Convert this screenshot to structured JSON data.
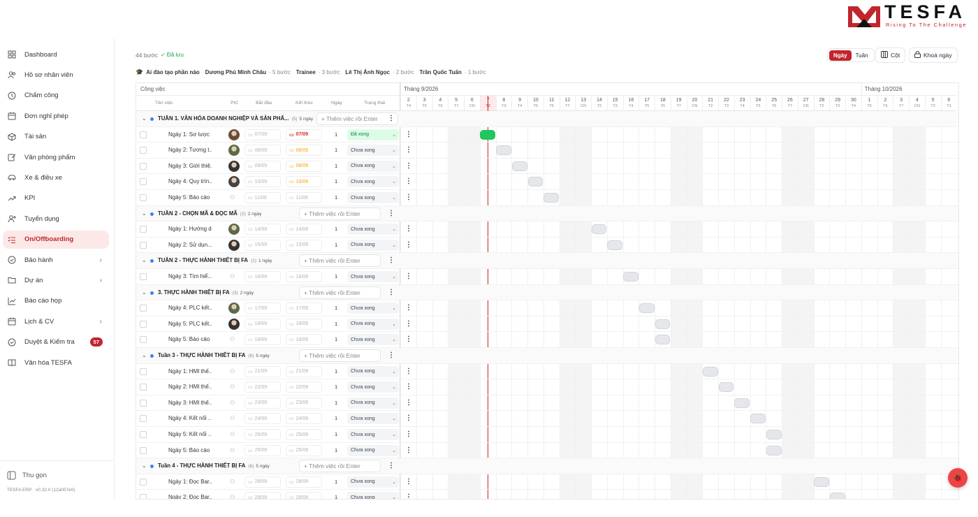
{
  "brand": {
    "name": "TESFA",
    "tagline": "Rising To The Challenge"
  },
  "sidebar": {
    "items": [
      {
        "label": "Dashboard",
        "icon": "grid-icon"
      },
      {
        "label": "Hồ sơ nhân viên",
        "icon": "users-icon"
      },
      {
        "label": "Chấm công",
        "icon": "clock-icon"
      },
      {
        "label": "Đơn nghỉ phép",
        "icon": "calendar-icon"
      },
      {
        "label": "Tài sản",
        "icon": "box-icon"
      },
      {
        "label": "Văn phòng phẩm",
        "icon": "edit-icon"
      },
      {
        "label": "Xe & điều xe",
        "icon": "car-icon"
      },
      {
        "label": "KPI",
        "icon": "trend-icon"
      },
      {
        "label": "Tuyển dụng",
        "icon": "user-plus-icon"
      },
      {
        "label": "On/Offboarding",
        "icon": "list-check-icon",
        "active": true
      },
      {
        "label": "Bảo hành",
        "icon": "check-circle-icon",
        "chevron": true
      },
      {
        "label": "Dự án",
        "icon": "folder-icon",
        "chevron": true
      },
      {
        "label": "Báo cáo họp",
        "icon": "chart-icon"
      },
      {
        "label": "Lịch & CV",
        "icon": "calendar-icon",
        "chevron": true
      },
      {
        "label": "Duyệt & Kiểm tra",
        "icon": "check-circle-icon",
        "badge": "57"
      },
      {
        "label": "Văn hóa TESFA",
        "icon": "book-icon"
      }
    ],
    "collapse_label": "Thu gọn",
    "version": "TESFA ERP · v0.32.0 (12a007e0)"
  },
  "toolbar": {
    "step_count": "44 bước",
    "saved": "✓ Đã lưu",
    "view_day": "Ngày",
    "view_week": "Tuần",
    "columns_label": "Cột",
    "lock_label": "Khoá ngày"
  },
  "summary": {
    "prefix": "Ai đào tạo phần nào",
    "people": [
      {
        "name": "Dương Phú Minh Châu",
        "steps": "· 5 bước"
      },
      {
        "name": "Trainee",
        "steps": "· 3 bước"
      },
      {
        "name": "Lê Thị Ánh Ngọc",
        "steps": "· 2 bước"
      },
      {
        "name": "Trần Quốc Tuấn",
        "steps": "· 1 bước"
      }
    ]
  },
  "table": {
    "section_label": "Công việc",
    "columns": {
      "name": "Tên việc",
      "pic": "PIC",
      "start": "Bắt đầu",
      "end": "Kết thúc",
      "days": "Ngày",
      "status": "Trạng thái"
    },
    "add_placeholder": "+ Thêm việc rồi Enter",
    "rows": [
      {
        "type": "group",
        "title": "TUẦN 1. VĂN HÓA DOANH NGHIỆP VÀ SẢN PHẨ...",
        "count": "(5)",
        "days": "5 ngày"
      },
      {
        "type": "task",
        "name": "Ngày 1: Sơ lược ...",
        "pic": "avatar",
        "start": "07/09",
        "end": "07/09",
        "days": "1",
        "status": "Đã xong",
        "end_style": "red",
        "done": true,
        "bar": [
          5,
          1
        ],
        "bar_color": "green"
      },
      {
        "type": "task",
        "name": "Ngày 2: Tương t...",
        "pic": "avatar",
        "start": "08/09",
        "end": "08/09",
        "days": "1",
        "status": "Chưa xong",
        "end_style": "orange",
        "bar": [
          6,
          1
        ]
      },
      {
        "type": "task",
        "name": "Ngày 3: Giới thiệ...",
        "pic": "avatar",
        "start": "09/09",
        "end": "09/09",
        "days": "1",
        "status": "Chưa xong",
        "end_style": "orange",
        "bar": [
          7,
          1
        ]
      },
      {
        "type": "task",
        "name": "Ngày 4: Quy trìn...",
        "pic": "avatar",
        "start": "10/09",
        "end": "10/09",
        "days": "1",
        "status": "Chưa xong",
        "end_style": "orange",
        "bar": [
          8,
          1
        ]
      },
      {
        "type": "task",
        "name": "Ngày 5: Báo cáo",
        "pic": "none",
        "start": "11/09",
        "end": "11/09",
        "days": "1",
        "status": "Chưa xong",
        "bar": [
          9,
          1
        ]
      },
      {
        "type": "group",
        "title": "TUẦN 2 - CHỌN MÃ & ĐỌC MÃ",
        "count": "(2)",
        "days": "2 ngày"
      },
      {
        "type": "task",
        "name": "Ngày 1: Hướng d...",
        "pic": "avatar",
        "start": "14/09",
        "end": "14/09",
        "days": "1",
        "status": "Chưa xong",
        "bar": [
          12,
          1
        ]
      },
      {
        "type": "task",
        "name": "Ngày 2: Sử dụn...",
        "pic": "avatar",
        "start": "15/09",
        "end": "15/09",
        "days": "1",
        "status": "Chưa xong",
        "bar": [
          13,
          1
        ]
      },
      {
        "type": "group",
        "title": "TUẦN 2 - THỰC HÀNH THIẾT BỊ FA",
        "count": "(1)",
        "days": "1 ngày"
      },
      {
        "type": "task",
        "name": "Ngày 3: Tìm hiể...",
        "pic": "none",
        "start": "16/09",
        "end": "16/09",
        "days": "1",
        "status": "Chưa xong",
        "bar": [
          14,
          1
        ]
      },
      {
        "type": "group",
        "title": "3. THỰC HÀNH THIẾT BỊ FA",
        "count": "(3)",
        "days": "2 ngày"
      },
      {
        "type": "task",
        "name": "Ngày 4: PLC kết...",
        "pic": "avatar",
        "start": "17/09",
        "end": "17/09",
        "days": "1",
        "status": "Chưa xong",
        "bar": [
          15,
          1
        ]
      },
      {
        "type": "task",
        "name": "Ngày 5: PLC kết...",
        "pic": "avatar",
        "start": "18/09",
        "end": "18/09",
        "days": "1",
        "status": "Chưa xong",
        "bar": [
          16,
          1
        ]
      },
      {
        "type": "task",
        "name": "Ngày 5: Báo cáo",
        "pic": "none",
        "start": "18/09",
        "end": "18/09",
        "days": "1",
        "status": "Chưa xong",
        "bar": [
          16,
          1
        ]
      },
      {
        "type": "group",
        "title": "Tuần 3 - THỰC HÀNH THIẾT BỊ FA",
        "count": "(6)",
        "days": "5 ngày"
      },
      {
        "type": "task",
        "name": "Ngày 1: HMI thế...",
        "pic": "none",
        "start": "21/09",
        "end": "21/09",
        "days": "1",
        "status": "Chưa xong",
        "bar": [
          19,
          1
        ]
      },
      {
        "type": "task",
        "name": "Ngày 2: HMI thế...",
        "pic": "none",
        "start": "22/09",
        "end": "22/09",
        "days": "1",
        "status": "Chưa xong",
        "bar": [
          20,
          1
        ]
      },
      {
        "type": "task",
        "name": "Ngày 3: HMI thế...",
        "pic": "none",
        "start": "23/09",
        "end": "23/09",
        "days": "1",
        "status": "Chưa xong",
        "bar": [
          21,
          1
        ]
      },
      {
        "type": "task",
        "name": "Ngày 4: Kết nối ...",
        "pic": "none",
        "start": "24/09",
        "end": "24/09",
        "days": "1",
        "status": "Chưa xong",
        "bar": [
          22,
          1
        ]
      },
      {
        "type": "task",
        "name": "Ngày 5: Kết nối ...",
        "pic": "none",
        "start": "25/09",
        "end": "25/09",
        "days": "1",
        "status": "Chưa xong",
        "bar": [
          23,
          1
        ]
      },
      {
        "type": "task",
        "name": "Ngày 5: Báo cáo",
        "pic": "none",
        "start": "25/09",
        "end": "25/09",
        "days": "1",
        "status": "Chưa xong",
        "bar": [
          23,
          1
        ]
      },
      {
        "type": "group",
        "title": "Tuần 4 - THỰC HÀNH THIẾT BỊ FA",
        "count": "(6)",
        "days": "5 ngày"
      },
      {
        "type": "task",
        "name": "Ngày 1: Đọc Bar...",
        "pic": "none",
        "start": "28/09",
        "end": "28/09",
        "days": "1",
        "status": "Chưa xong",
        "bar": [
          26,
          1
        ]
      },
      {
        "type": "task",
        "name": "Ngày 2: Đọc Bar...",
        "pic": "none",
        "start": "29/09",
        "end": "29/09",
        "days": "1",
        "status": "Chưa xong",
        "bar": [
          27,
          1
        ]
      }
    ]
  },
  "timeline": {
    "months": [
      {
        "label": "Tháng 9/2026",
        "start": 0,
        "span": 29
      },
      {
        "label": "Tháng 10/2026",
        "start": 29,
        "span": 6
      }
    ],
    "days": [
      {
        "d": "2",
        "w": "T4"
      },
      {
        "d": "3",
        "w": "T5"
      },
      {
        "d": "4",
        "w": "T6"
      },
      {
        "d": "5",
        "w": "T7"
      },
      {
        "d": "6",
        "w": "CN"
      },
      {
        "d": "7",
        "w": "T2",
        "today": true
      },
      {
        "d": "8",
        "w": "T3"
      },
      {
        "d": "9",
        "w": "T4"
      },
      {
        "d": "10",
        "w": "T5"
      },
      {
        "d": "11",
        "w": "T6"
      },
      {
        "d": "12",
        "w": "T7"
      },
      {
        "d": "13",
        "w": "CN"
      },
      {
        "d": "14",
        "w": "T2"
      },
      {
        "d": "15",
        "w": "T3"
      },
      {
        "d": "16",
        "w": "T4"
      },
      {
        "d": "17",
        "w": "T5"
      },
      {
        "d": "18",
        "w": "T6"
      },
      {
        "d": "19",
        "w": "T7"
      },
      {
        "d": "20",
        "w": "CN"
      },
      {
        "d": "21",
        "w": "T2"
      },
      {
        "d": "22",
        "w": "T3"
      },
      {
        "d": "23",
        "w": "T4"
      },
      {
        "d": "24",
        "w": "T5"
      },
      {
        "d": "25",
        "w": "T6"
      },
      {
        "d": "26",
        "w": "T7"
      },
      {
        "d": "27",
        "w": "CN"
      },
      {
        "d": "28",
        "w": "T2"
      },
      {
        "d": "29",
        "w": "T3"
      },
      {
        "d": "30",
        "w": "T4"
      },
      {
        "d": "1",
        "w": "T5"
      },
      {
        "d": "2",
        "w": "T6"
      },
      {
        "d": "3",
        "w": "T7"
      },
      {
        "d": "4",
        "w": "CN"
      },
      {
        "d": "5",
        "w": "T2"
      },
      {
        "d": "6",
        "w": "T3"
      }
    ]
  },
  "colors": {
    "accent": "#c0262d",
    "done": "#22c55e",
    "group_dot": "#3b82f6"
  },
  "fab": {
    "icon": "bug-icon"
  }
}
